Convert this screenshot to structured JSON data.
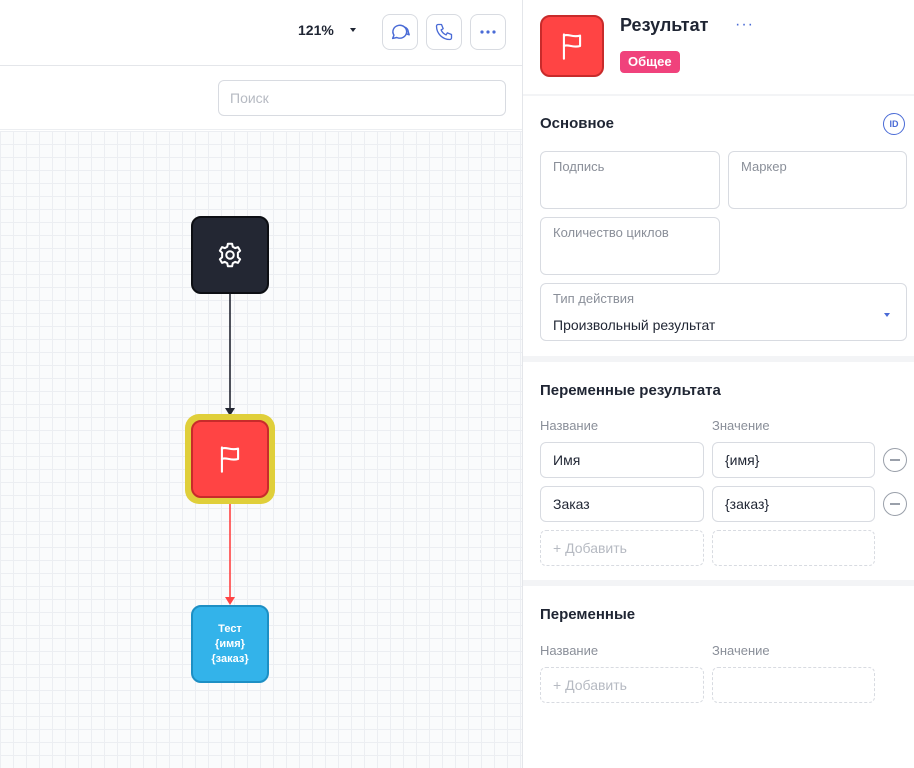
{
  "toolbar": {
    "zoom": "121%",
    "icons": {
      "chat": "chat-bubbles-icon",
      "call": "phone-icon",
      "more": "more-dots-icon"
    }
  },
  "search": {
    "placeholder": "Поиск"
  },
  "canvas": {
    "nodes": [
      {
        "type": "start",
        "icon": "gear-icon"
      },
      {
        "type": "result",
        "icon": "flag-icon",
        "selected": true
      },
      {
        "type": "message",
        "lines": [
          "Тест",
          "{имя}",
          "{заказ}"
        ]
      }
    ],
    "colors": {
      "start_edge": "#232733",
      "result_edge": "#ff4444",
      "highlight": "#e0cf3a",
      "message_node": "#33b3ea"
    }
  },
  "panel": {
    "title": "Результат",
    "more": "···",
    "badge": "Общее",
    "colors": {
      "badge": "#f0427c",
      "node": "#ff4444",
      "accent": "#4a6bd6"
    },
    "basic": {
      "title": "Основное",
      "id_label": "ID",
      "caption_label": "Подпись",
      "marker_label": "Маркер",
      "cycles_label": "Количество циклов",
      "action_type_label": "Тип действия",
      "action_type_value": "Произвольный результат"
    },
    "result_vars": {
      "title": "Переменные результата",
      "col_name": "Название",
      "col_value": "Значение",
      "rows": [
        {
          "name": "Имя",
          "value": "{имя}"
        },
        {
          "name": "Заказ",
          "value": "{заказ}"
        }
      ],
      "add_label": "+ Добавить"
    },
    "vars": {
      "title": "Переменные",
      "col_name": "Название",
      "col_value": "Значение",
      "add_label": "+ Добавить"
    }
  }
}
